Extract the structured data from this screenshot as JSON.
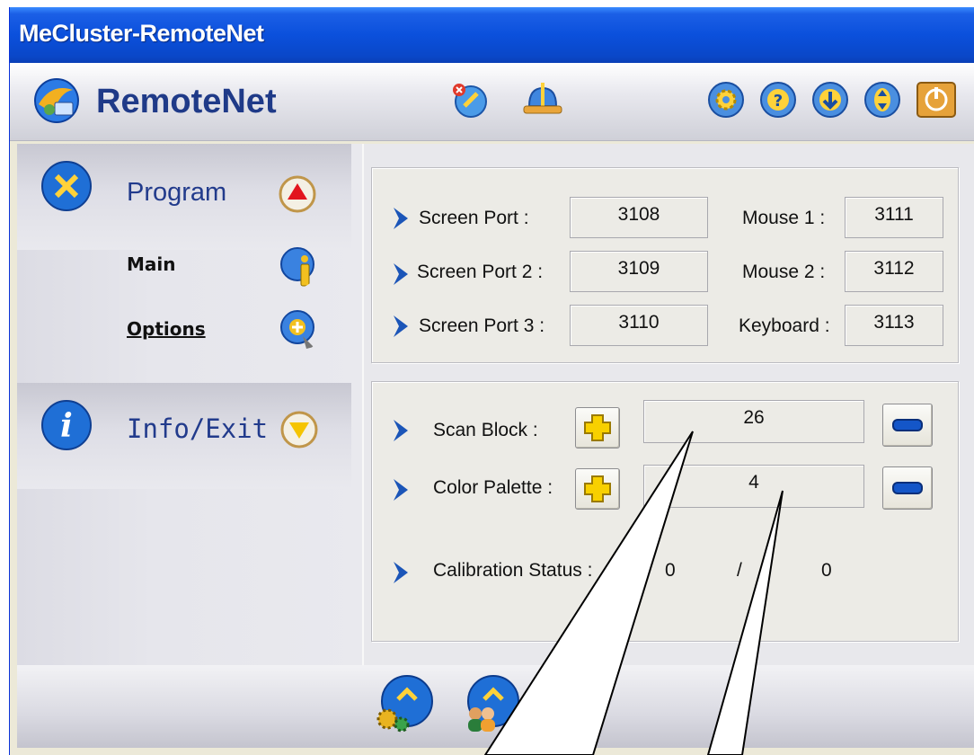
{
  "window": {
    "title": "MeCluster-RemoteNet"
  },
  "header": {
    "app_title": "RemoteNet",
    "icons": [
      "remotenet-logo-icon",
      "disconnect-satellite-icon",
      "network-bell-icon",
      "settings-gear-icon",
      "help-icon",
      "download-icon",
      "updown-icon",
      "power-icon"
    ]
  },
  "sidebar": {
    "program": {
      "title": "Program",
      "items": [
        {
          "label": "Main"
        },
        {
          "label": "Options"
        }
      ]
    },
    "info": {
      "title": "Info/Exit"
    }
  },
  "ports": {
    "rows": [
      {
        "label": "Screen Port :",
        "value": "3108",
        "label2": "Mouse 1 :",
        "value2": "3111"
      },
      {
        "label": "Screen Port 2 :",
        "value": "3109",
        "label2": "Mouse 2 :",
        "value2": "3112"
      },
      {
        "label": "Screen Port 3 :",
        "value": "3110",
        "label2": "Keyboard :",
        "value2": "3113"
      }
    ]
  },
  "settings": {
    "scan_block": {
      "label": "Scan Block :",
      "value": "26"
    },
    "color_palette": {
      "label": "Color Palette :",
      "value": "4"
    },
    "calibration": {
      "label": "Calibration Status :",
      "value1": "0",
      "sep": "/",
      "value2": "0"
    }
  },
  "colors": {
    "titlebar": "#0a47c8",
    "accent_blue": "#1f3a88",
    "button_yellow": "#f5c400",
    "button_blue": "#1456c8"
  }
}
